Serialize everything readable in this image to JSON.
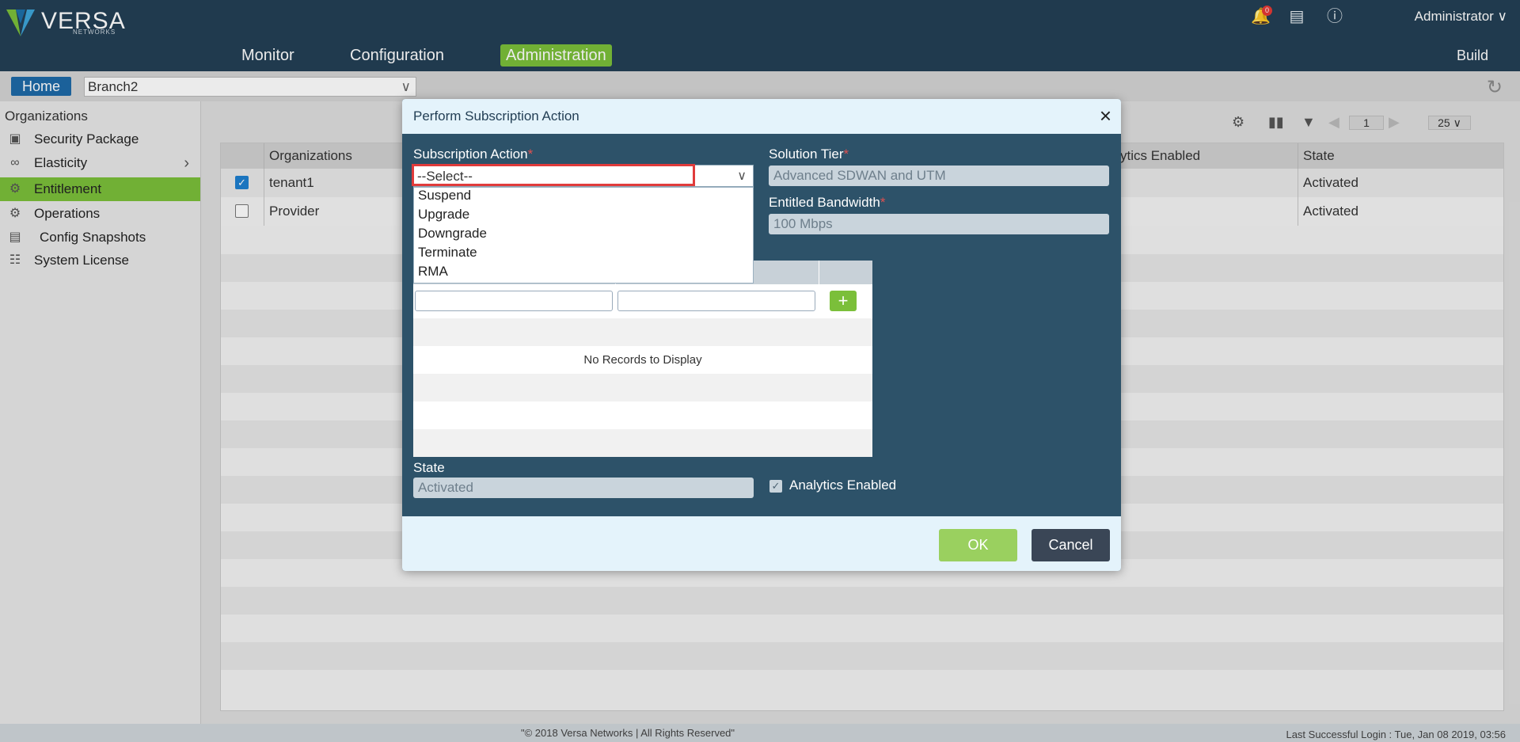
{
  "brand": {
    "name": "VERSA",
    "sub": "NETWORKS"
  },
  "nav": {
    "monitor": "Monitor",
    "configuration": "Configuration",
    "administration": "Administration",
    "build": "Build"
  },
  "top_right": {
    "notification_count": "0",
    "user": "Administrator"
  },
  "subbar": {
    "home": "Home",
    "branch": "Branch2"
  },
  "sidebar": {
    "heading": "Organizations",
    "items": [
      {
        "label": "Security Package",
        "icon": "security-package-icon"
      },
      {
        "label": "Elasticity",
        "icon": "elasticity-icon"
      },
      {
        "label": "Entitlement",
        "icon": "entitlement-icon"
      },
      {
        "label": "Operations",
        "icon": "operations-icon"
      },
      {
        "label": "Config Snapshots",
        "icon": "config-snapshots-icon"
      },
      {
        "label": "System License",
        "icon": "system-license-icon"
      }
    ]
  },
  "grid": {
    "page": "1",
    "page_size": "25",
    "columns": [
      "Organizations",
      "ytics Enabled",
      "State"
    ],
    "rows": [
      {
        "checked": true,
        "org": "tenant1",
        "state": "Activated"
      },
      {
        "checked": false,
        "org": "Provider",
        "state": "Activated"
      }
    ]
  },
  "modal": {
    "title": "Perform Subscription Action",
    "subscription_action_label": "Subscription Action",
    "subscription_action_value": "--Select--",
    "options": [
      "Suspend",
      "Upgrade",
      "Downgrade",
      "Terminate",
      "RMA"
    ],
    "solution_tier_label": "Solution Tier",
    "solution_tier_value": "Advanced SDWAN and UTM",
    "entitled_bandwidth_label": "Entitled Bandwidth",
    "entitled_bandwidth_value": "100 Mbps",
    "no_records": "No Records to Display",
    "state_label": "State",
    "state_value": "Activated",
    "analytics_label": "Analytics Enabled",
    "ok": "OK",
    "cancel": "Cancel"
  },
  "footer": {
    "copyright": "\"© 2018 Versa Networks | All Rights Reserved\"",
    "last_login": "Last Successful Login : Tue, Jan 08 2019, 03:56"
  },
  "colors": {
    "header": "#233f55",
    "accent": "#7bbf3a",
    "modal": "#2d5269",
    "highlight": "#e03b3b"
  }
}
